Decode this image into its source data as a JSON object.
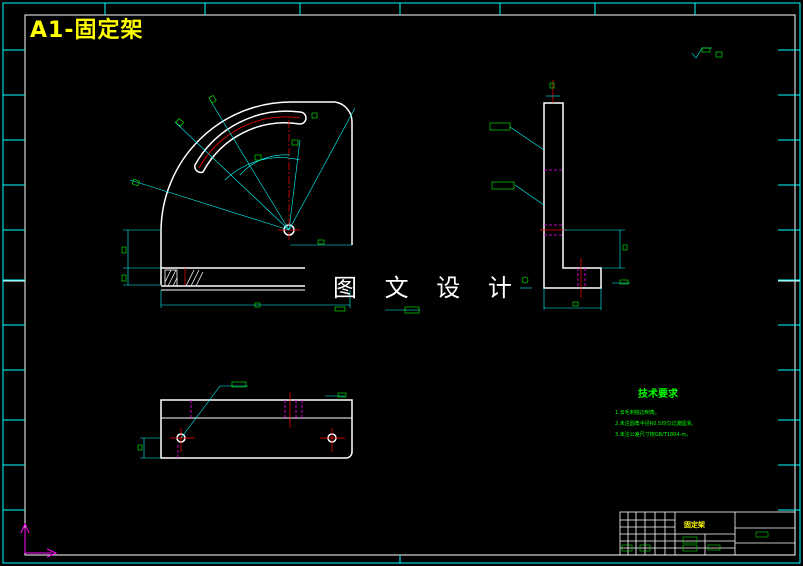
{
  "title": "A1-固定架",
  "watermark": "图 文 设 计",
  "technical_requirements": {
    "heading": "技术要求",
    "items": [
      "1.去毛刺锐边倒角。",
      "2.未注圆角半径R0.5均匀过渡圆滑。",
      "3.未注公差尺寸按GB/T1804-m。"
    ]
  },
  "title_block": {
    "part_name": "固定架"
  },
  "colors": {
    "background": "#000000",
    "outline": "#ffffff",
    "dimension": "#00ffff",
    "centerline": "#ff0000",
    "hidden": "#ff00ff",
    "text_green": "#00ff00",
    "title_yellow": "#ffff00"
  }
}
